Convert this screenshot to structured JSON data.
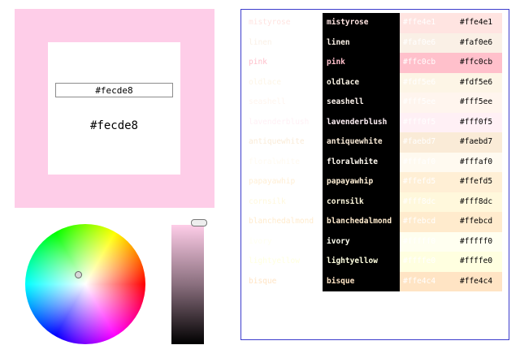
{
  "selected": {
    "hex": "#fecde8",
    "input_value": "#fecde8",
    "label": "#fecde8"
  },
  "colors": [
    {
      "name": "mistyrose",
      "hex": "#ffe4e1"
    },
    {
      "name": "linen",
      "hex": "#faf0e6"
    },
    {
      "name": "pink",
      "hex": "#ffc0cb"
    },
    {
      "name": "oldlace",
      "hex": "#fdf5e6"
    },
    {
      "name": "seashell",
      "hex": "#fff5ee"
    },
    {
      "name": "lavenderblush",
      "hex": "#fff0f5"
    },
    {
      "name": "antiquewhite",
      "hex": "#faebd7"
    },
    {
      "name": "floralwhite",
      "hex": "#fffaf0"
    },
    {
      "name": "papayawhip",
      "hex": "#ffefd5"
    },
    {
      "name": "cornsilk",
      "hex": "#fff8dc"
    },
    {
      "name": "blanchedalmond",
      "hex": "#ffebcd"
    },
    {
      "name": "ivory",
      "hex": "#fffff0"
    },
    {
      "name": "lightyellow",
      "hex": "#ffffe0"
    },
    {
      "name": "bisque",
      "hex": "#ffe4c4"
    }
  ],
  "brightness_slider": {
    "value": 1.0
  }
}
